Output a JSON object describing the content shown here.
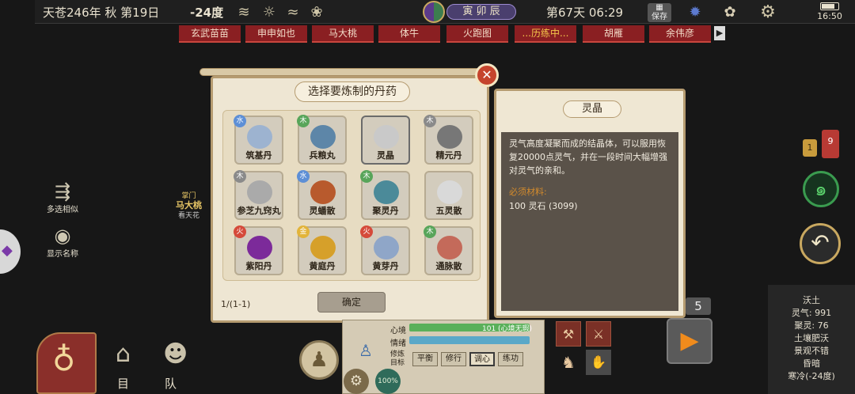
{
  "topbar": {
    "date": "天苍246年 秋 第19日",
    "temperature": "-24度",
    "hour_badge": "寅 卯 辰",
    "day_time": "第67天 06:29",
    "save_label": "保存",
    "clock": "16:50"
  },
  "name_tabs": [
    "玄武苗苗",
    "申申如也",
    "马大桃",
    "体牛",
    "火跑图",
    "...历练中...",
    "胡雁",
    "余伟彦"
  ],
  "left_menu": {
    "multi_select": "多选相似",
    "show_names": "显示名称",
    "fragment_1": "掌门",
    "fragment_2": "马大桃",
    "fragment_3": "看天花"
  },
  "dialog": {
    "title": "选择要炼制的丹药",
    "pager": "1/(1-1)",
    "confirm": "确定",
    "items": [
      {
        "name": "筑基丹",
        "element": "水",
        "color": "#5d8fd6",
        "pic": "#9db3d0"
      },
      {
        "name": "兵粮丸",
        "element": "木",
        "color": "#58a55a",
        "pic": "#5d86a8"
      },
      {
        "name": "灵晶",
        "element": "",
        "color": "",
        "pic": "#c9c9c9"
      },
      {
        "name": "精元丹",
        "element": "木",
        "color": "#8a8a8a",
        "pic": "#777777"
      },
      {
        "name": "参芝九窍丸",
        "element": "木",
        "color": "#8a8a8a",
        "pic": "#aaaaaa"
      },
      {
        "name": "灵蟠散",
        "element": "水",
        "color": "#5d8fd6",
        "pic": "#b85a2d"
      },
      {
        "name": "聚灵丹",
        "element": "木",
        "color": "#58a55a",
        "pic": "#4b8a99"
      },
      {
        "name": "五灵散",
        "element": "",
        "color": "",
        "pic": "#d9d9d9"
      },
      {
        "name": "紫阳丹",
        "element": "火",
        "color": "#d54a3a",
        "pic": "#7c2a9a"
      },
      {
        "name": "黄庭丹",
        "element": "金",
        "color": "#e2b43a",
        "pic": "#d6a02a"
      },
      {
        "name": "黄芽丹",
        "element": "火",
        "color": "#d54a3a",
        "pic": "#8fa6c8"
      },
      {
        "name": "通脉散",
        "element": "木",
        "color": "#58a55a",
        "pic": "#c46a5a"
      }
    ]
  },
  "info": {
    "title": "灵晶",
    "description": "灵气高度凝聚而成的结晶体，可以服用恢复20000点灵气，并在一段时间大幅增强对灵气的亲和。",
    "required_label": "必须材料:",
    "materials": "100 灵石 (3099)"
  },
  "right_panel": {
    "lines": [
      "沃土",
      "灵气: 991",
      "聚灵: 76",
      "土壤肥沃",
      "景观不错",
      "昏暗",
      "寒冷(-24度)"
    ]
  },
  "badges": {
    "a": "1",
    "b": "9",
    "count": "5"
  },
  "status": {
    "mood_label": "心境",
    "mood_value": "101 (心境无瑕)",
    "emotion_label": "情绪",
    "training_label": "修炼目标",
    "buttons": [
      "平衡",
      "修行",
      "调心",
      "练功"
    ],
    "percent": "100%"
  },
  "bottom": {
    "goal": "目标",
    "team": "队列"
  }
}
